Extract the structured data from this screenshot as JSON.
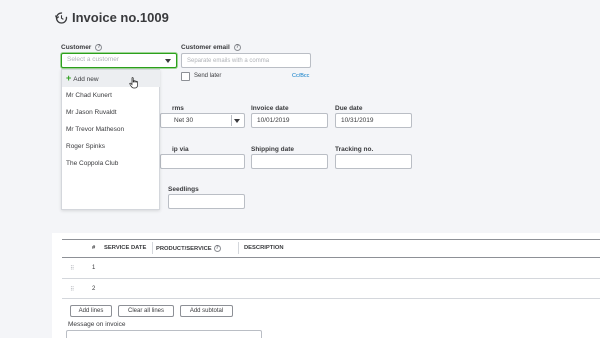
{
  "header": {
    "title": "Invoice no.1009",
    "icon": "history-clock-icon"
  },
  "customer": {
    "label": "Customer",
    "placeholder": "Select a customer"
  },
  "customer_email": {
    "label": "Customer email",
    "placeholder": "Separate emails with a comma",
    "send_later": "Send later",
    "cc_bcc": "Cc/Bcc"
  },
  "dropdown": {
    "add_new": "Add new",
    "items": [
      "Mr Chad Kunert",
      "Mr Jason Ruvaldt",
      "Mr Trevor Matheson",
      "Roger Spinks",
      "The Coppola Club"
    ]
  },
  "terms": {
    "label": "rms",
    "value": "Net 30"
  },
  "invoice_date": {
    "label": "Invoice date",
    "value": "10/01/2019"
  },
  "due_date": {
    "label": "Due date",
    "value": "10/31/2019"
  },
  "ship_via": {
    "label": "ip via"
  },
  "shipping_date": {
    "label": "Shipping date"
  },
  "tracking_no": {
    "label": "Tracking no."
  },
  "seedlings": {
    "label": "Seedlings"
  },
  "table": {
    "headers": {
      "num": "#",
      "service_date": "SERVICE DATE",
      "product": "PRODUCT/SERVICE",
      "description": "DESCRIPTION"
    },
    "rows": [
      "1",
      "2"
    ]
  },
  "buttons": {
    "add_lines": "Add lines",
    "clear_all_lines": "Clear all lines",
    "add_subtotal": "Add subtotal"
  },
  "message": {
    "label": "Message on invoice"
  },
  "colors": {
    "accent_green": "#2ca01c",
    "link_blue": "#0077c5",
    "border": "#babec5"
  }
}
